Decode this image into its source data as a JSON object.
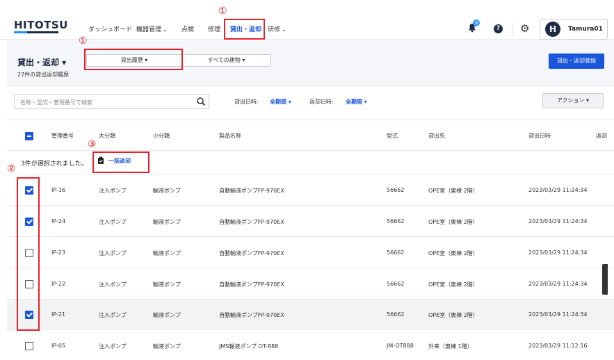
{
  "header": {
    "logo": "HITOTSU",
    "nav": [
      {
        "label": "ダッシュボード",
        "caret": ""
      },
      {
        "label": "機器管理",
        "caret": "⌄"
      },
      {
        "label": "点検",
        "caret": ""
      },
      {
        "label": "修理",
        "caret": ""
      },
      {
        "label": "貸出・返却",
        "caret": ""
      },
      {
        "label": "研修",
        "caret": "⌄"
      }
    ],
    "notification_count": "3",
    "help_icon": "?",
    "settings_icon": "gear-icon",
    "user": {
      "initial": "H",
      "name": "Tamura01"
    }
  },
  "annotations": [
    "①",
    "①",
    "②",
    "③"
  ],
  "page": {
    "title": "貸出・返却 ▾",
    "subtitle": "27件の貸出返却履歴",
    "segment_left": "貸出履歴 ▾",
    "segment_right": "すべての建物 ▾",
    "primary_button": "貸出・返却登録"
  },
  "filters": {
    "search_placeholder": "名称・型式・管理番号で検索",
    "lend_date_label": "貸出日時:",
    "lend_date_value": "全期間 ▾",
    "return_date_label": "返却日時:",
    "return_date_value": "全期間 ▾",
    "action_button": "アクション ▾"
  },
  "table": {
    "headers": [
      "管理番号",
      "大分類",
      "小分類",
      "製品名称",
      "型式",
      "貸出先",
      "貸出日時",
      "返却"
    ],
    "selection_text": "3件が選択されました。",
    "bulk_return_label": "一括返却",
    "rows": [
      {
        "checked": true,
        "id": "IP-16",
        "major": "注入ポンプ",
        "minor": "輸液ポンプ",
        "product": "自動輸液ポンプFP-970EX",
        "model": "56662",
        "dest": "OPE室（東棟 2階）",
        "date": "2023/03/29 11:24:34"
      },
      {
        "checked": true,
        "id": "IP-24",
        "major": "注入ポンプ",
        "minor": "輸液ポンプ",
        "product": "自動輸液ポンプFP-970EX",
        "model": "56662",
        "dest": "OPE室（東棟 2階）",
        "date": "2023/03/29 11:24:34"
      },
      {
        "checked": false,
        "id": "IP-23",
        "major": "注入ポンプ",
        "minor": "輸液ポンプ",
        "product": "自動輸液ポンプFP-970EX",
        "model": "56662",
        "dest": "OPE室（東棟 2階）",
        "date": "2023/03/29 11:24:34"
      },
      {
        "checked": false,
        "id": "IP-22",
        "major": "注入ポンプ",
        "minor": "輸液ポンプ",
        "product": "自動輸液ポンプFP-970EX",
        "model": "56662",
        "dest": "OPE室（東棟 2階）",
        "date": "2023/03/29 11:24:34"
      },
      {
        "checked": true,
        "id": "IP-21",
        "major": "注入ポンプ",
        "minor": "輸液ポンプ",
        "product": "自動輸液ポンプFP-970EX",
        "model": "56662",
        "dest": "OPE室（東棟 2階）",
        "date": "2023/03/29 11:24:34"
      },
      {
        "checked": false,
        "id": "IP-05",
        "major": "注入ポンプ",
        "minor": "輸液ポンプ",
        "product": "JMS輸液ポンプ OT-888",
        "model": "JM-OT888",
        "dest": "外来（東棟 1階）",
        "date": "2023/03/29 11:12:16"
      }
    ]
  },
  "colors": {
    "accent": "#1a56db",
    "annotation": "#e8202a",
    "navy": "#1f2a44"
  }
}
